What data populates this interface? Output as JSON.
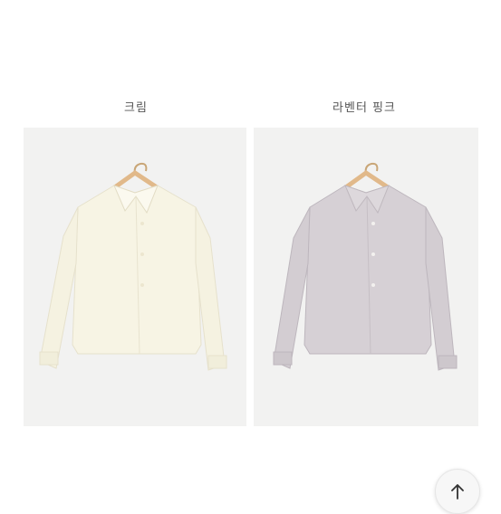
{
  "products": [
    {
      "color_name": "크림",
      "swatch": "#f7f4e4",
      "shade": "#e6e1cc"
    },
    {
      "color_name": "라벤터 핑크",
      "swatch": "#d6d0d5",
      "shade": "#bdb6bd"
    }
  ],
  "hanger_color": "#e1b98a",
  "scroll_top_icon": "arrow-up-icon"
}
